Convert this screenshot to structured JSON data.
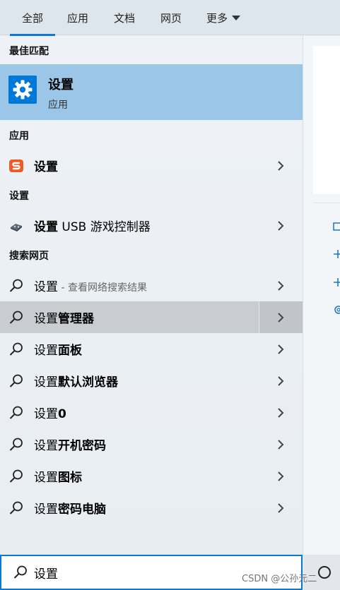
{
  "tabs": [
    {
      "label": "全部"
    },
    {
      "label": "应用"
    },
    {
      "label": "文档"
    },
    {
      "label": "网页"
    },
    {
      "label": "更多"
    }
  ],
  "best_match": {
    "header": "最佳匹配",
    "title": "设置",
    "type": "应用"
  },
  "apps": {
    "header": "应用",
    "item": "设置"
  },
  "settings": {
    "header": "设置",
    "item_bold": "设置",
    "item_rest": " USB 游戏控制器"
  },
  "web": {
    "header": "搜索网页",
    "first_bold": "设置",
    "first_sub": " - 查看网络搜索结果",
    "suggestions": [
      {
        "prefix": "设置",
        "rest": "管理器"
      },
      {
        "prefix": "设置",
        "rest": "面板"
      },
      {
        "prefix": "设置",
        "rest": "默认浏览器"
      },
      {
        "prefix": "设置",
        "rest": "0"
      },
      {
        "prefix": "设置",
        "rest": "开机密码"
      },
      {
        "prefix": "设置",
        "rest": "图标"
      },
      {
        "prefix": "设置",
        "rest": "密码电脑"
      }
    ]
  },
  "search": {
    "value": "设置"
  },
  "watermark": "CSDN @公孙元二",
  "colors": {
    "accent": "#0a78d4",
    "best_match_bg": "#9bc6e8",
    "highlight_bg": "#c9ccd0"
  }
}
